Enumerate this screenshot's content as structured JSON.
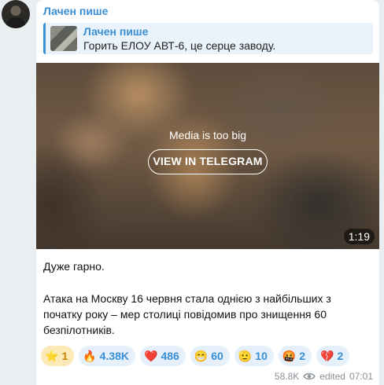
{
  "channel": {
    "name": "Лачен пише"
  },
  "reply": {
    "author": "Лачен пише",
    "text": "Горить ЕЛОУ АВТ-6, це серце заводу."
  },
  "media": {
    "notice": "Media is too big",
    "button_label": "VIEW IN TELEGRAM",
    "duration": "1:19"
  },
  "message": {
    "paragraphs": [
      "Дуже гарно.",
      "Атака на Москву 16 червня стала однією з найбільших з початку року – мер столиці повідомив про знищення 60 безпілотників."
    ]
  },
  "reactions": [
    {
      "icon": "star-icon",
      "glyph": "⭐",
      "count": "1"
    },
    {
      "icon": "fire-icon",
      "glyph": "🔥",
      "count": "4.38K"
    },
    {
      "icon": "heart-icon",
      "glyph": "❤️",
      "count": "486"
    },
    {
      "icon": "smile-icon",
      "glyph": "😁",
      "count": "60"
    },
    {
      "icon": "pointing-hand-icon",
      "glyph": "🫡",
      "count": "10"
    },
    {
      "icon": "angry-face-icon",
      "glyph": "🤬",
      "count": "2"
    },
    {
      "icon": "broken-heart-icon",
      "glyph": "💔",
      "count": "2"
    }
  ],
  "footer": {
    "views": "58.8K",
    "edited_label": "edited",
    "time": "07:01"
  },
  "colors": {
    "accent": "#3a8fd4",
    "background": "#e9eef1",
    "reaction_bg": "#e5f0fa",
    "paid_reaction_bg": "#fbe9b7"
  }
}
